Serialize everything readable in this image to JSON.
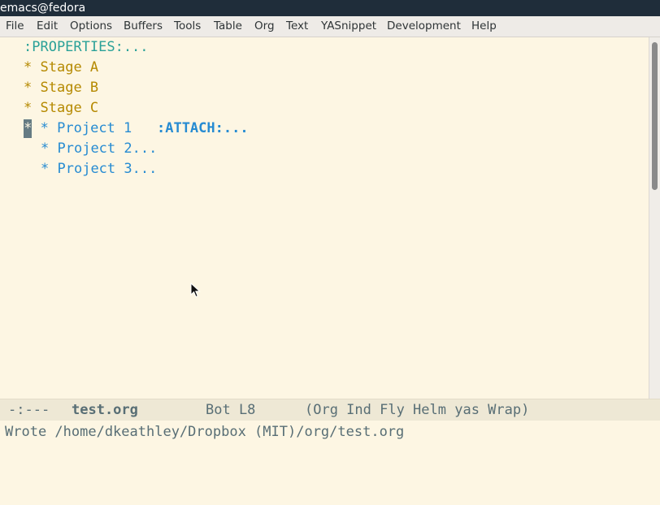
{
  "window": {
    "title": "emacs@fedora"
  },
  "menu": [
    "File",
    "Edit",
    "Options",
    "Buffers",
    "Tools",
    "Table",
    "Org",
    "Text",
    "YASnippet",
    "Development",
    "Help"
  ],
  "buffer": {
    "properties": ":PROPERTIES:...",
    "star": "*",
    "stages": [
      "Stage A",
      "Stage B",
      "Stage C"
    ],
    "project1": {
      "title": "Project 1",
      "tag": ":ATTACH:..."
    },
    "projects_folded": [
      "Project 2...",
      "Project 3..."
    ]
  },
  "modeline": {
    "status": "-:---",
    "buffer_name": "test.org",
    "position": "Bot L8",
    "modes": "(Org Ind Fly Helm yas Wrap)"
  },
  "echo_area": "Wrote /home/dkeathley/Dropbox (MIT)/org/test.org",
  "colors": {
    "background": "#fdf6e3",
    "heading1": "#b58900",
    "heading2": "#268bd2",
    "drawer": "#2aa198"
  },
  "icons": {
    "pointer": "mouse-pointer-icon"
  }
}
